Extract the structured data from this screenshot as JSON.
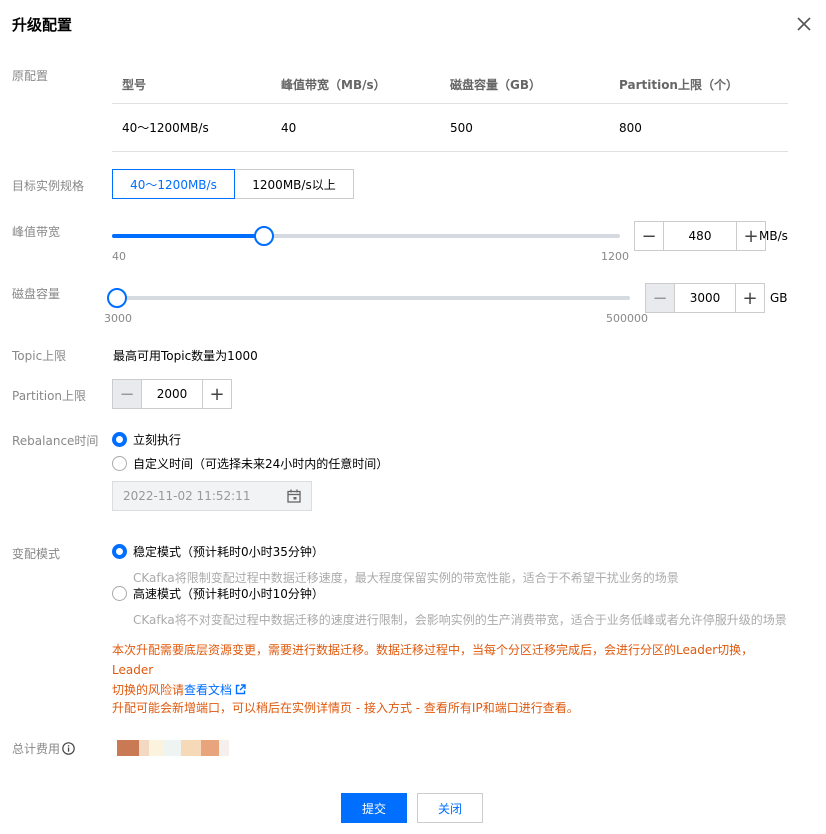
{
  "dialog": {
    "title": "升级配置"
  },
  "original": {
    "label": "原配置",
    "headers": [
      "型号",
      "峰值带宽（MB/s）",
      "磁盘容量（GB）",
      "Partition上限（个）"
    ],
    "row": [
      "40～1200MB/s",
      "40",
      "500",
      "800"
    ]
  },
  "spec": {
    "label": "目标实例规格",
    "options": [
      "40～1200MB/s",
      "1200MB/s以上"
    ],
    "selected": "40～1200MB/s"
  },
  "bandwidth": {
    "label": "峰值带宽",
    "min": "40",
    "max": "1200",
    "value": "480",
    "unit": "MB/s",
    "fraction": 0.3
  },
  "disk": {
    "label": "磁盘容量",
    "min": "3000",
    "max": "500000",
    "value": "3000",
    "unit": "GB",
    "fraction": 0
  },
  "topic": {
    "label": "Topic上限",
    "text": "最高可用Topic数量为1000"
  },
  "partition": {
    "label": "Partition上限",
    "value": "2000"
  },
  "rebalance": {
    "label": "Rebalance时间",
    "option_now": "立刻执行",
    "option_custom": "自定义时间（可选择未来24小时内的任意时间）",
    "datetime_placeholder": "2022-11-02 11:52:11"
  },
  "mode": {
    "label": "变配模式",
    "stable": "稳定模式（预计耗时0小时35分钟）",
    "stable_hint": "CKafka将限制变配过程中数据迁移速度，最大程度保留实例的带宽性能，适合于不希望干扰业务的场景",
    "fast": "高速模式（预计耗时0小时10分钟）",
    "fast_hint": "CKafka将不对变配过程中数据迁移的速度进行限制，会影响实例的生产消费带宽，适合于业务低峰或者允许停服升级的场景"
  },
  "warning": {
    "line1": "本次升配需要底层资源变更，需要进行数据迁移。数据迁移过程中，当每个分区迁移完成后，会进行分区的Leader切换，Leader",
    "line2_prefix": "切换的风险请",
    "doc_link": "查看文档",
    "note": "升配可能会新增端口，可以稍后在实例详情页 - 接入方式 - 查看所有IP和端口进行查看。"
  },
  "total": {
    "label": "总计费用"
  },
  "footer": {
    "submit": "提交",
    "close": "关闭"
  },
  "colors": {
    "primary": "#006eff",
    "warning": "#e0590d"
  }
}
